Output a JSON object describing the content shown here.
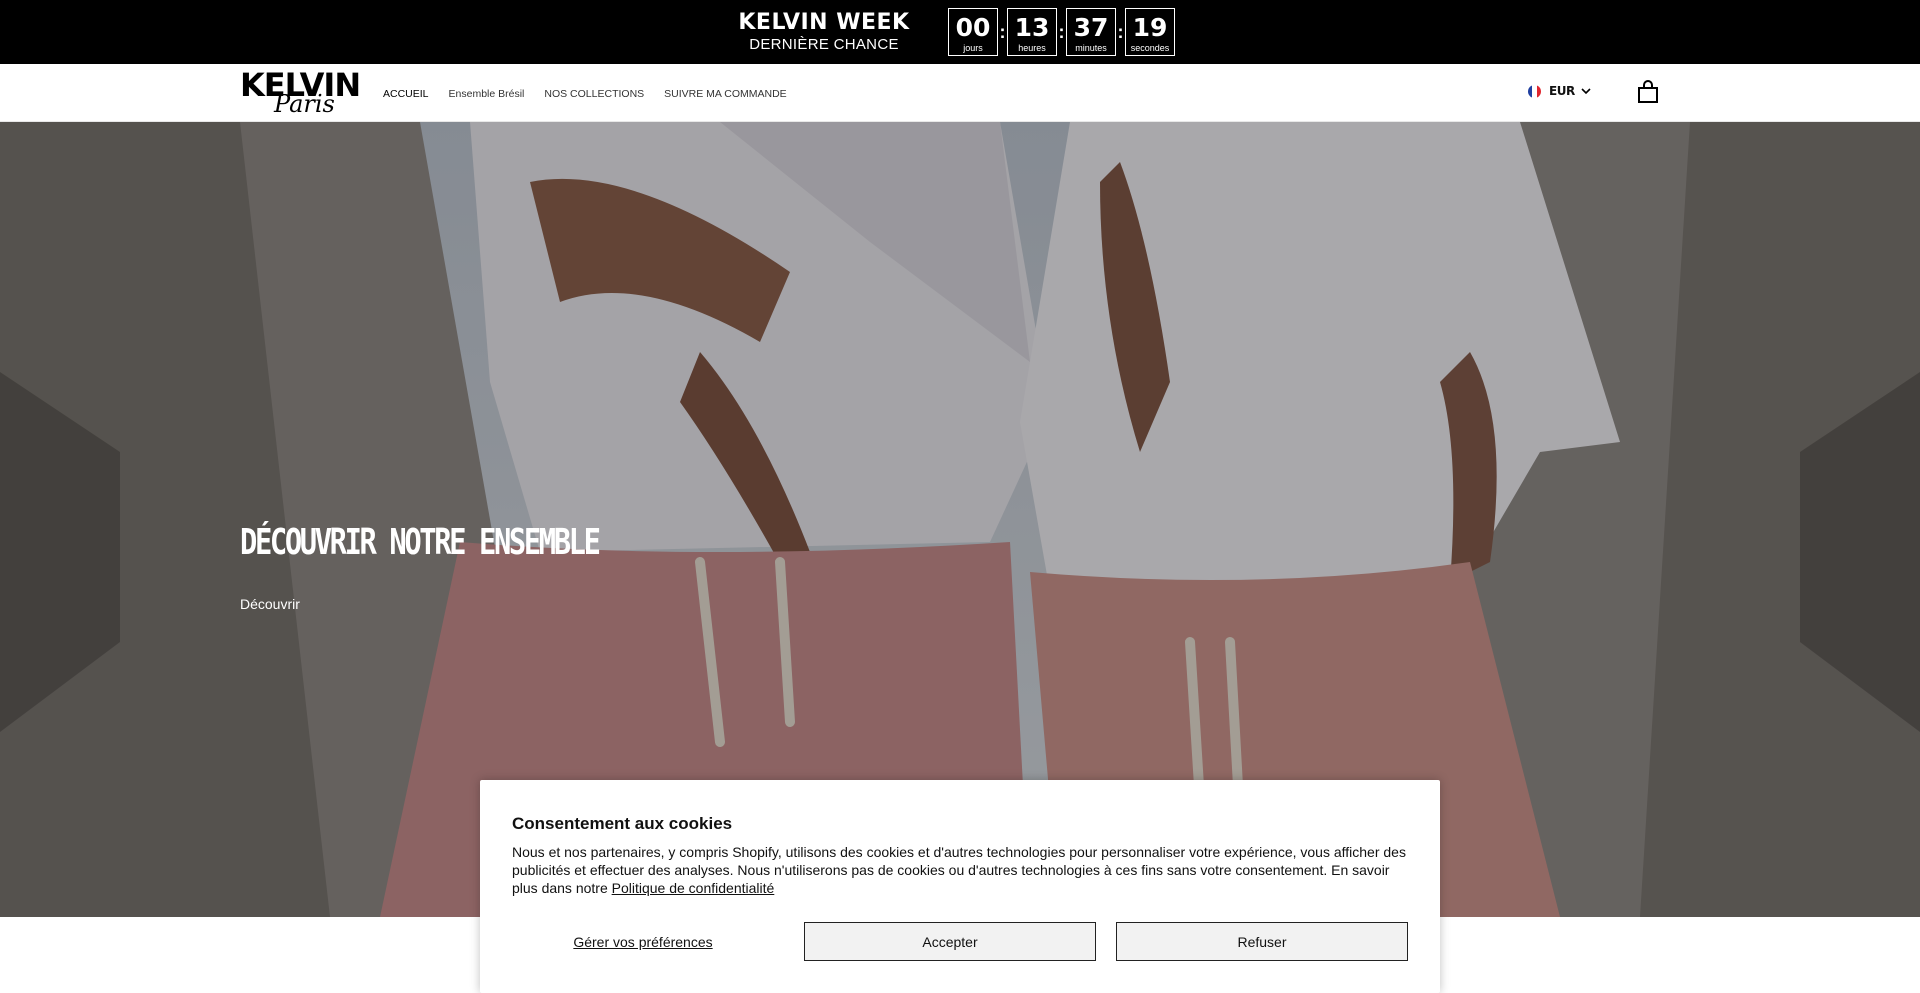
{
  "announcement": {
    "title": "KELVIN WEEK",
    "subtitle": "DERNIÈRE CHANCE",
    "countdown": [
      {
        "value": "00",
        "label": "jours"
      },
      {
        "value": "13",
        "label": "heures"
      },
      {
        "value": "37",
        "label": "minutes"
      },
      {
        "value": "19",
        "label": "secondes"
      }
    ],
    "separator": ":"
  },
  "header": {
    "logo_main": "KELVIN",
    "logo_script": "Paris",
    "nav": [
      {
        "label": "ACCUEIL"
      },
      {
        "label": "Ensemble Brésil"
      },
      {
        "label": "NOS COLLECTIONS"
      },
      {
        "label": "SUIVRE MA COMMANDE"
      }
    ],
    "currency": "EUR",
    "icons": {
      "flag": "france-flag-icon",
      "chevron": "chevron-down-icon",
      "cart": "shopping-bag-icon"
    }
  },
  "hero": {
    "title": "DÉCOUVRIR NOTRE ENSEMBLE",
    "link": "Découvrir"
  },
  "cookie": {
    "title": "Consentement aux cookies",
    "text": "Nous et nos partenaires, y compris Shopify, utilisons des cookies et d'autres technologies pour personnaliser votre expérience, vous afficher des publicités et effectuer des analyses. Nous n'utiliserons pas de cookies ou d'autres technologies à ces fins sans votre consentement. En savoir plus dans notre",
    "link": "Politique de confidentialité",
    "manage": "Gérer vos préférences",
    "accept": "Accepter",
    "refuse": "Refuser"
  },
  "colors": {
    "bar": "#000000",
    "header": "#ffffff",
    "shorts": "#c58f86",
    "tshirt": "#e6e4ea",
    "concrete": "#8a8580"
  }
}
